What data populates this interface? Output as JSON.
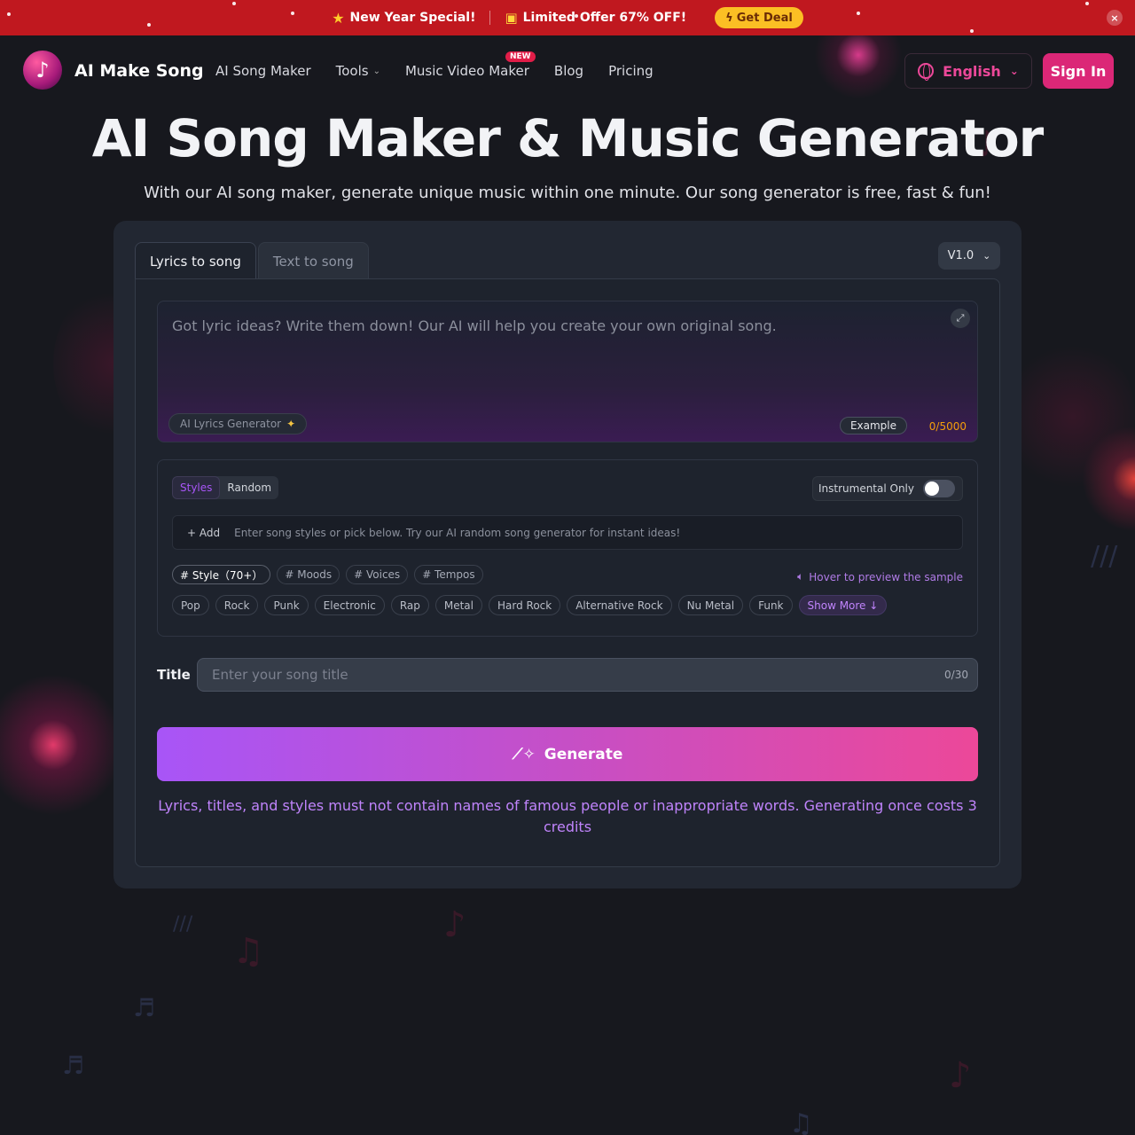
{
  "promo": {
    "special": "New Year Special!",
    "offer": "Limited Offer 67% OFF!",
    "deal_label": "Get Deal",
    "close_symbol": "×"
  },
  "header": {
    "brand": "AI Make Song",
    "nav": {
      "song_maker": "AI Song Maker",
      "tools": "Tools",
      "video": "Music Video Maker",
      "video_badge": "NEW",
      "blog": "Blog",
      "pricing": "Pricing"
    },
    "language": "English",
    "sign_in": "Sign In"
  },
  "hero": {
    "title": "AI Song Maker & Music Generator",
    "subtitle": "With our AI song maker, generate unique music within one minute. Our song generator is free, fast & fun!"
  },
  "card": {
    "tabs": [
      "Lyrics to song",
      "Text to song"
    ],
    "active_tab": "Lyrics to song",
    "version": "V1.0",
    "lyrics": {
      "placeholder": "Got lyric ideas? Write them down! Our AI will help you create your own original song.",
      "ai_generator": "AI Lyrics Generator",
      "example": "Example",
      "count": "0/5000"
    },
    "styles": {
      "mode_styles": "Styles",
      "mode_random": "Random",
      "instrumental_label": "Instrumental Only",
      "instrumental_on": false,
      "add_label": "+ Add",
      "input_placeholder": "Enter song styles or pick below. Try our AI random song generator for instant ideas!",
      "categories": [
        "# Style（70+）",
        "# Moods",
        "# Voices",
        "# Tempos"
      ],
      "hover_hint": "Hover to preview the sample",
      "tags": [
        "Pop",
        "Rock",
        "Punk",
        "Electronic",
        "Rap",
        "Metal",
        "Hard Rock",
        "Alternative Rock",
        "Nu Metal",
        "Funk"
      ],
      "show_more": "Show More ↓"
    },
    "title_field": {
      "label": "Title",
      "placeholder": "Enter your song title",
      "count": "0/30"
    },
    "generate_label": "Generate",
    "warning": "Lyrics, titles, and styles must not contain names of famous people or inappropriate words. Generating once costs 3 credits"
  },
  "colors": {
    "promo_bg": "#c0181f",
    "accent_pink": "#db2777",
    "accent_purple": "#a855f7",
    "card_bg": "#222732",
    "page_bg": "#17181e"
  },
  "icons": [
    "star-icon",
    "gift-icon",
    "lightning-icon",
    "close-icon",
    "logo-music-icon",
    "chevron-down-icon",
    "globe-icon",
    "expand-icon",
    "sparkles-icon",
    "speaker-icon",
    "magic-wand-icon"
  ]
}
